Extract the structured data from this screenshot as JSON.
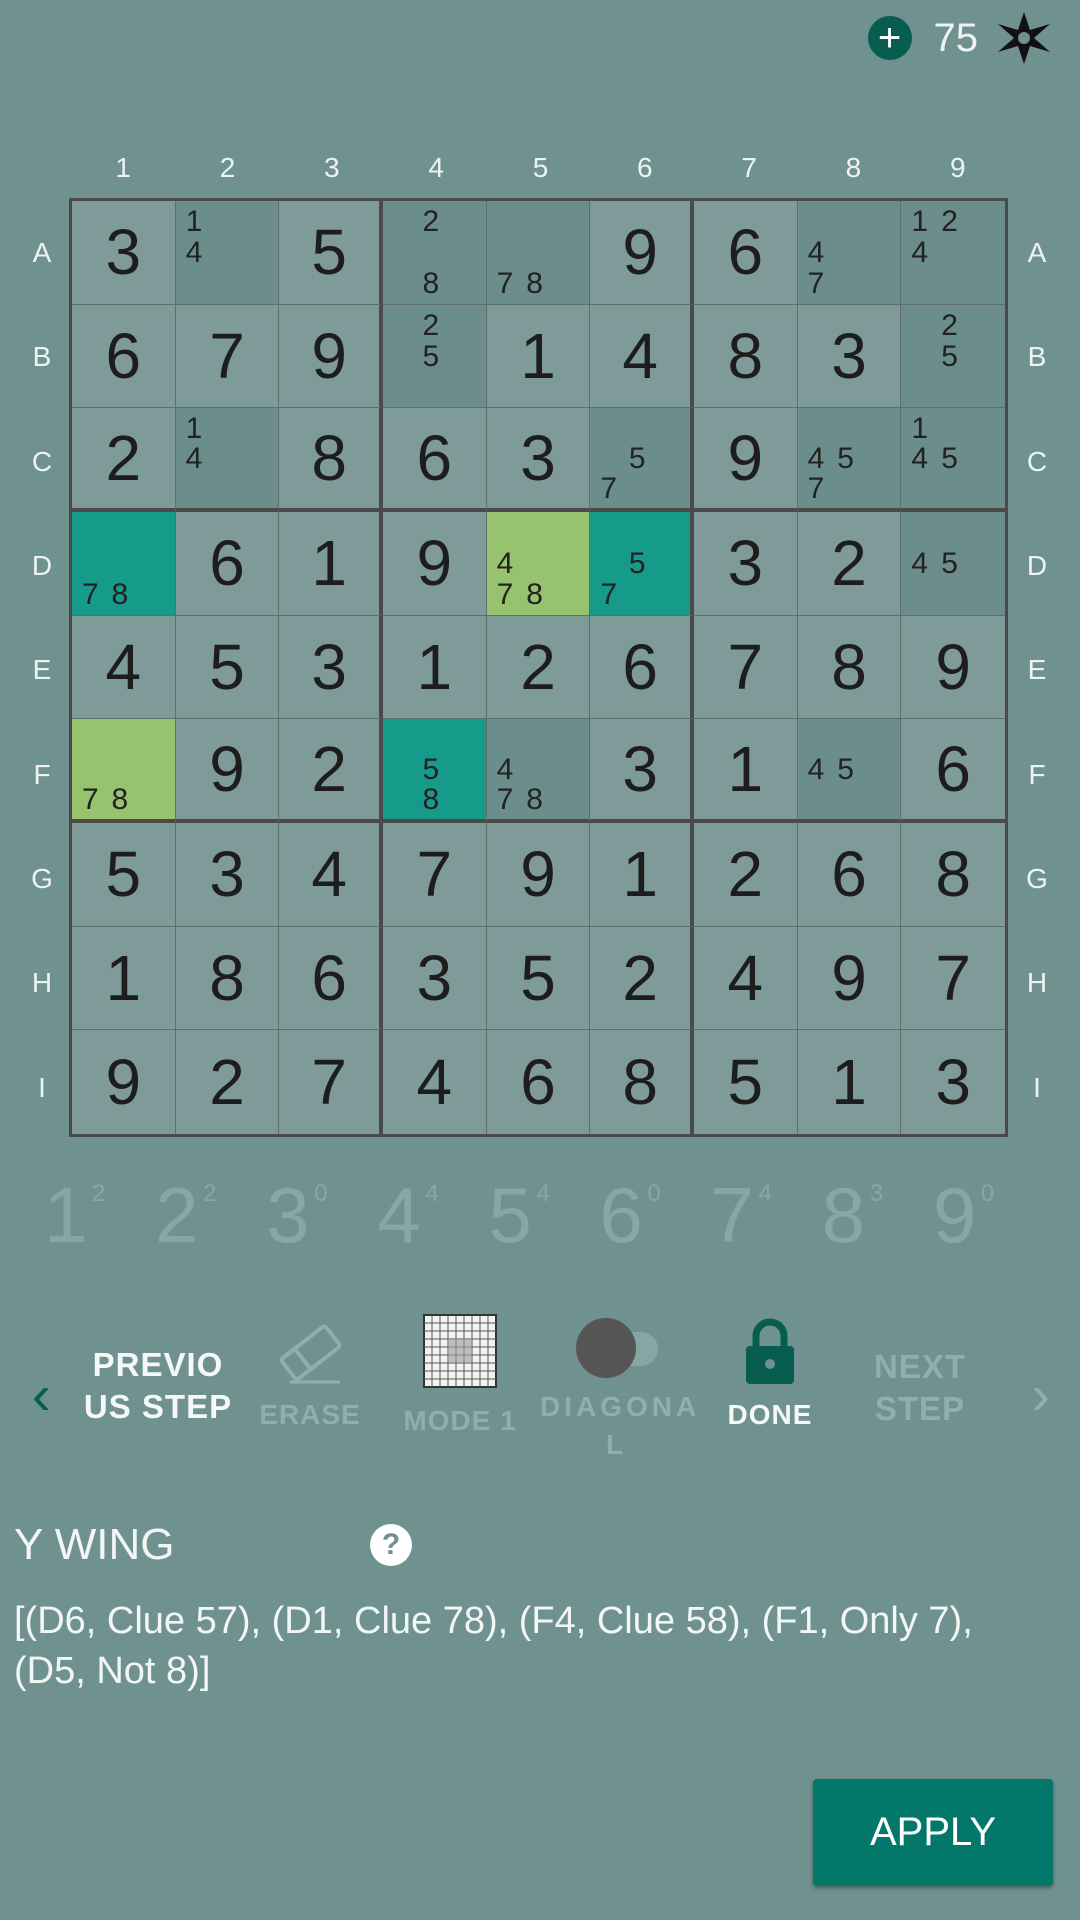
{
  "topbar": {
    "coins": "75",
    "plus_symbol": "+"
  },
  "col_labels": [
    "1",
    "2",
    "3",
    "4",
    "5",
    "6",
    "7",
    "8",
    "9"
  ],
  "row_labels": [
    "A",
    "B",
    "C",
    "D",
    "E",
    "F",
    "G",
    "H",
    "I"
  ],
  "board": [
    [
      {
        "v": "3"
      },
      {
        "n": [
          "1",
          "",
          "",
          "4",
          "",
          "",
          "",
          "",
          ""
        ]
      },
      {
        "v": "5"
      },
      {
        "n": [
          "",
          "2",
          "",
          "",
          "",
          "",
          "",
          "8",
          ""
        ]
      },
      {
        "n": [
          "",
          "",
          "",
          "",
          "",
          "",
          "7",
          "8",
          ""
        ]
      },
      {
        "v": "9"
      },
      {
        "v": "6"
      },
      {
        "n": [
          "",
          "",
          "",
          "4",
          "",
          "",
          "7",
          "",
          ""
        ]
      },
      {
        "n": [
          "1",
          "2",
          "",
          "4",
          "",
          "",
          "",
          "",
          ""
        ]
      }
    ],
    [
      {
        "v": "6"
      },
      {
        "v": "7"
      },
      {
        "v": "9"
      },
      {
        "n": [
          "",
          "2",
          "",
          "",
          "5",
          "",
          "",
          "",
          ""
        ]
      },
      {
        "v": "1"
      },
      {
        "v": "4"
      },
      {
        "v": "8"
      },
      {
        "v": "3"
      },
      {
        "n": [
          "",
          "2",
          "",
          "",
          "5",
          "",
          "",
          "",
          ""
        ]
      }
    ],
    [
      {
        "v": "2"
      },
      {
        "n": [
          "1",
          "",
          "",
          "4",
          "",
          "",
          "",
          "",
          ""
        ]
      },
      {
        "v": "8"
      },
      {
        "v": "6"
      },
      {
        "v": "3"
      },
      {
        "n": [
          "",
          "",
          "",
          "",
          "5",
          "",
          "7",
          "",
          ""
        ]
      },
      {
        "v": "9"
      },
      {
        "n": [
          "",
          "",
          "",
          "4",
          "5",
          "",
          "7",
          "",
          ""
        ]
      },
      {
        "n": [
          "1",
          "",
          "",
          "4",
          "5",
          "",
          "",
          "",
          ""
        ]
      }
    ],
    [
      {
        "n": [
          "",
          "",
          "",
          "",
          "",
          "",
          "7",
          "8",
          ""
        ],
        "hl": "teal"
      },
      {
        "v": "6"
      },
      {
        "v": "1"
      },
      {
        "v": "9"
      },
      {
        "n": [
          "",
          "",
          "",
          "4",
          "",
          "",
          "7",
          "8",
          ""
        ],
        "hl": "green"
      },
      {
        "n": [
          "",
          "",
          "",
          "",
          "5",
          "",
          "7",
          "",
          ""
        ],
        "hl": "teal"
      },
      {
        "v": "3"
      },
      {
        "v": "2"
      },
      {
        "n": [
          "",
          "",
          "",
          "4",
          "5",
          "",
          "",
          "",
          ""
        ]
      }
    ],
    [
      {
        "v": "4"
      },
      {
        "v": "5"
      },
      {
        "v": "3"
      },
      {
        "v": "1"
      },
      {
        "v": "2"
      },
      {
        "v": "6"
      },
      {
        "v": "7"
      },
      {
        "v": "8"
      },
      {
        "v": "9"
      }
    ],
    [
      {
        "n": [
          "",
          "",
          "",
          "",
          "",
          "",
          "7",
          "8",
          ""
        ],
        "hl": "green"
      },
      {
        "v": "9"
      },
      {
        "v": "2"
      },
      {
        "n": [
          "",
          "",
          "",
          "",
          "5",
          "",
          "",
          "8",
          ""
        ],
        "hl": "teal"
      },
      {
        "n": [
          "",
          "",
          "",
          "4",
          "",
          "",
          "7",
          "8",
          ""
        ]
      },
      {
        "v": "3"
      },
      {
        "v": "1"
      },
      {
        "n": [
          "",
          "",
          "",
          "4",
          "5",
          "",
          "",
          "",
          ""
        ]
      },
      {
        "v": "6"
      }
    ],
    [
      {
        "v": "5"
      },
      {
        "v": "3"
      },
      {
        "v": "4"
      },
      {
        "v": "7"
      },
      {
        "v": "9"
      },
      {
        "v": "1"
      },
      {
        "v": "2"
      },
      {
        "v": "6"
      },
      {
        "v": "8"
      }
    ],
    [
      {
        "v": "1"
      },
      {
        "v": "8"
      },
      {
        "v": "6"
      },
      {
        "v": "3"
      },
      {
        "v": "5"
      },
      {
        "v": "2"
      },
      {
        "v": "4"
      },
      {
        "v": "9"
      },
      {
        "v": "7"
      }
    ],
    [
      {
        "v": "9"
      },
      {
        "v": "2"
      },
      {
        "v": "7"
      },
      {
        "v": "4"
      },
      {
        "v": "6"
      },
      {
        "v": "8"
      },
      {
        "v": "5"
      },
      {
        "v": "1"
      },
      {
        "v": "3"
      }
    ]
  ],
  "counters": [
    {
      "digit": "1",
      "count": "2"
    },
    {
      "digit": "2",
      "count": "2"
    },
    {
      "digit": "3",
      "count": "0"
    },
    {
      "digit": "4",
      "count": "4"
    },
    {
      "digit": "5",
      "count": "4"
    },
    {
      "digit": "6",
      "count": "0"
    },
    {
      "digit": "7",
      "count": "4"
    },
    {
      "digit": "8",
      "count": "3"
    },
    {
      "digit": "9",
      "count": "0"
    }
  ],
  "tools": {
    "prev_label_1": "PREVIO",
    "prev_label_2": "US STEP",
    "erase_label": "ERASE",
    "mode_label": "MODE 1",
    "diagonal_label_1": "DIAGONA",
    "diagonal_label_2": "L",
    "done_label": "DONE",
    "next_label_1": "NEXT",
    "next_label_2": "STEP"
  },
  "hint": {
    "title": "Y WING",
    "help_symbol": "?",
    "body": "[(D6, Clue 57), (D1, Clue 78), (F4, Clue 58), (F1, Only 7), (D5, Not 8)]"
  },
  "apply_label": "APPLY",
  "colors": {
    "background": "#6f9290",
    "accent": "#03786a",
    "highlight_green": "#97c26e",
    "highlight_teal": "#169a8a"
  }
}
